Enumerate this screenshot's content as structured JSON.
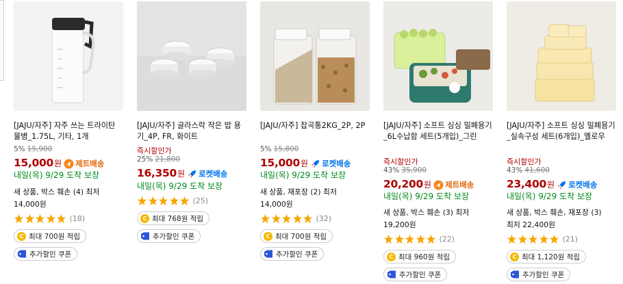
{
  "colors": {
    "price": "#ae0000",
    "arrival": "#00891a",
    "rocket": "#0073e9",
    "jet": "#e5670a",
    "star": "#f6a600"
  },
  "icons": [
    "star-icon",
    "rocket-delivery-icon",
    "jet-delivery-icon",
    "coin-icon",
    "coupon-tag-icon"
  ],
  "products": [
    {
      "title": "[JAJU/자주] 자주 쓰는 트라이탄 물병_1.75L, 기타, 1개",
      "discount_pct": "5%",
      "original_price": "15,900",
      "instant_discount": "",
      "price": "15,000",
      "won": "원",
      "delivery_badge": "제트배송",
      "delivery_type": "jet",
      "arrival": "내일(목) 9/29 도착 보장",
      "condition": "새 상품, 박스 훼손 (4) 최저",
      "unit_price": "14,000원",
      "rating": 5,
      "review_count": "(18)",
      "cashback": "최대 700원 적립",
      "coupon": "추가할인 쿠폰"
    },
    {
      "title": "[JAJU/자주] 글라스락 작은 밥 용기_4P, FR, 화이트",
      "discount_pct": "25%",
      "original_price": "21,800",
      "instant_discount": "즉시할인가",
      "price": "16,350",
      "won": "원",
      "delivery_badge": "로켓배송",
      "delivery_type": "rocket",
      "arrival": "내일(목) 9/29 도착 보장",
      "condition": "",
      "unit_price": "",
      "rating": 5,
      "review_count": "(25)",
      "cashback": "최대 768원 적립",
      "coupon": "추가할인 쿠폰"
    },
    {
      "title": "[JAJU/자주] 잡곡통2KG_2P, 2P",
      "discount_pct": "5%",
      "original_price": "15,800",
      "instant_discount": "",
      "price": "15,000",
      "won": "원",
      "delivery_badge": "로켓배송",
      "delivery_type": "rocket",
      "arrival": "내일(목) 9/29 도착 보장",
      "condition": "새 상품, 재포장 (2) 최저",
      "unit_price": "14,000원",
      "rating": 5,
      "review_count": "(32)",
      "cashback": "최대 700원 적립",
      "coupon": "추가할인 쿠폰"
    },
    {
      "title": "[JAJU/자주] 소프트 싱싱 밀폐용기_6L수납함 세트(5개입)_그린",
      "discount_pct": "43%",
      "original_price": "35,900",
      "instant_discount": "즉시할인가",
      "price": "20,200",
      "won": "원",
      "delivery_badge": "제트배송",
      "delivery_type": "jet",
      "arrival": "내일(목) 9/29 도착 보장",
      "condition": "새 상품, 박스 훼손 (3) 최저",
      "unit_price": "19,200원",
      "rating": 5,
      "review_count": "(22)",
      "cashback": "최대 960원 적립",
      "coupon": "추가할인 쿠폰"
    },
    {
      "title": "[JAJU/자주] 소프트 싱싱 밀폐용기_실속구성 세트(6개입)_옐로우",
      "discount_pct": "43%",
      "original_price": "41,600",
      "instant_discount": "즉시할인가",
      "price": "23,400",
      "won": "원",
      "delivery_badge": "로켓배송",
      "delivery_type": "rocket",
      "arrival": "내일(목) 9/29 도착 보장",
      "condition": "새 상품, 박스 훼손, 재포장 (3)",
      "unit_price": "최저 22,400원",
      "rating": 5,
      "review_count": "(21)",
      "cashback": "최대 1,120원 적립",
      "coupon": "추가할인 쿠폰"
    }
  ]
}
